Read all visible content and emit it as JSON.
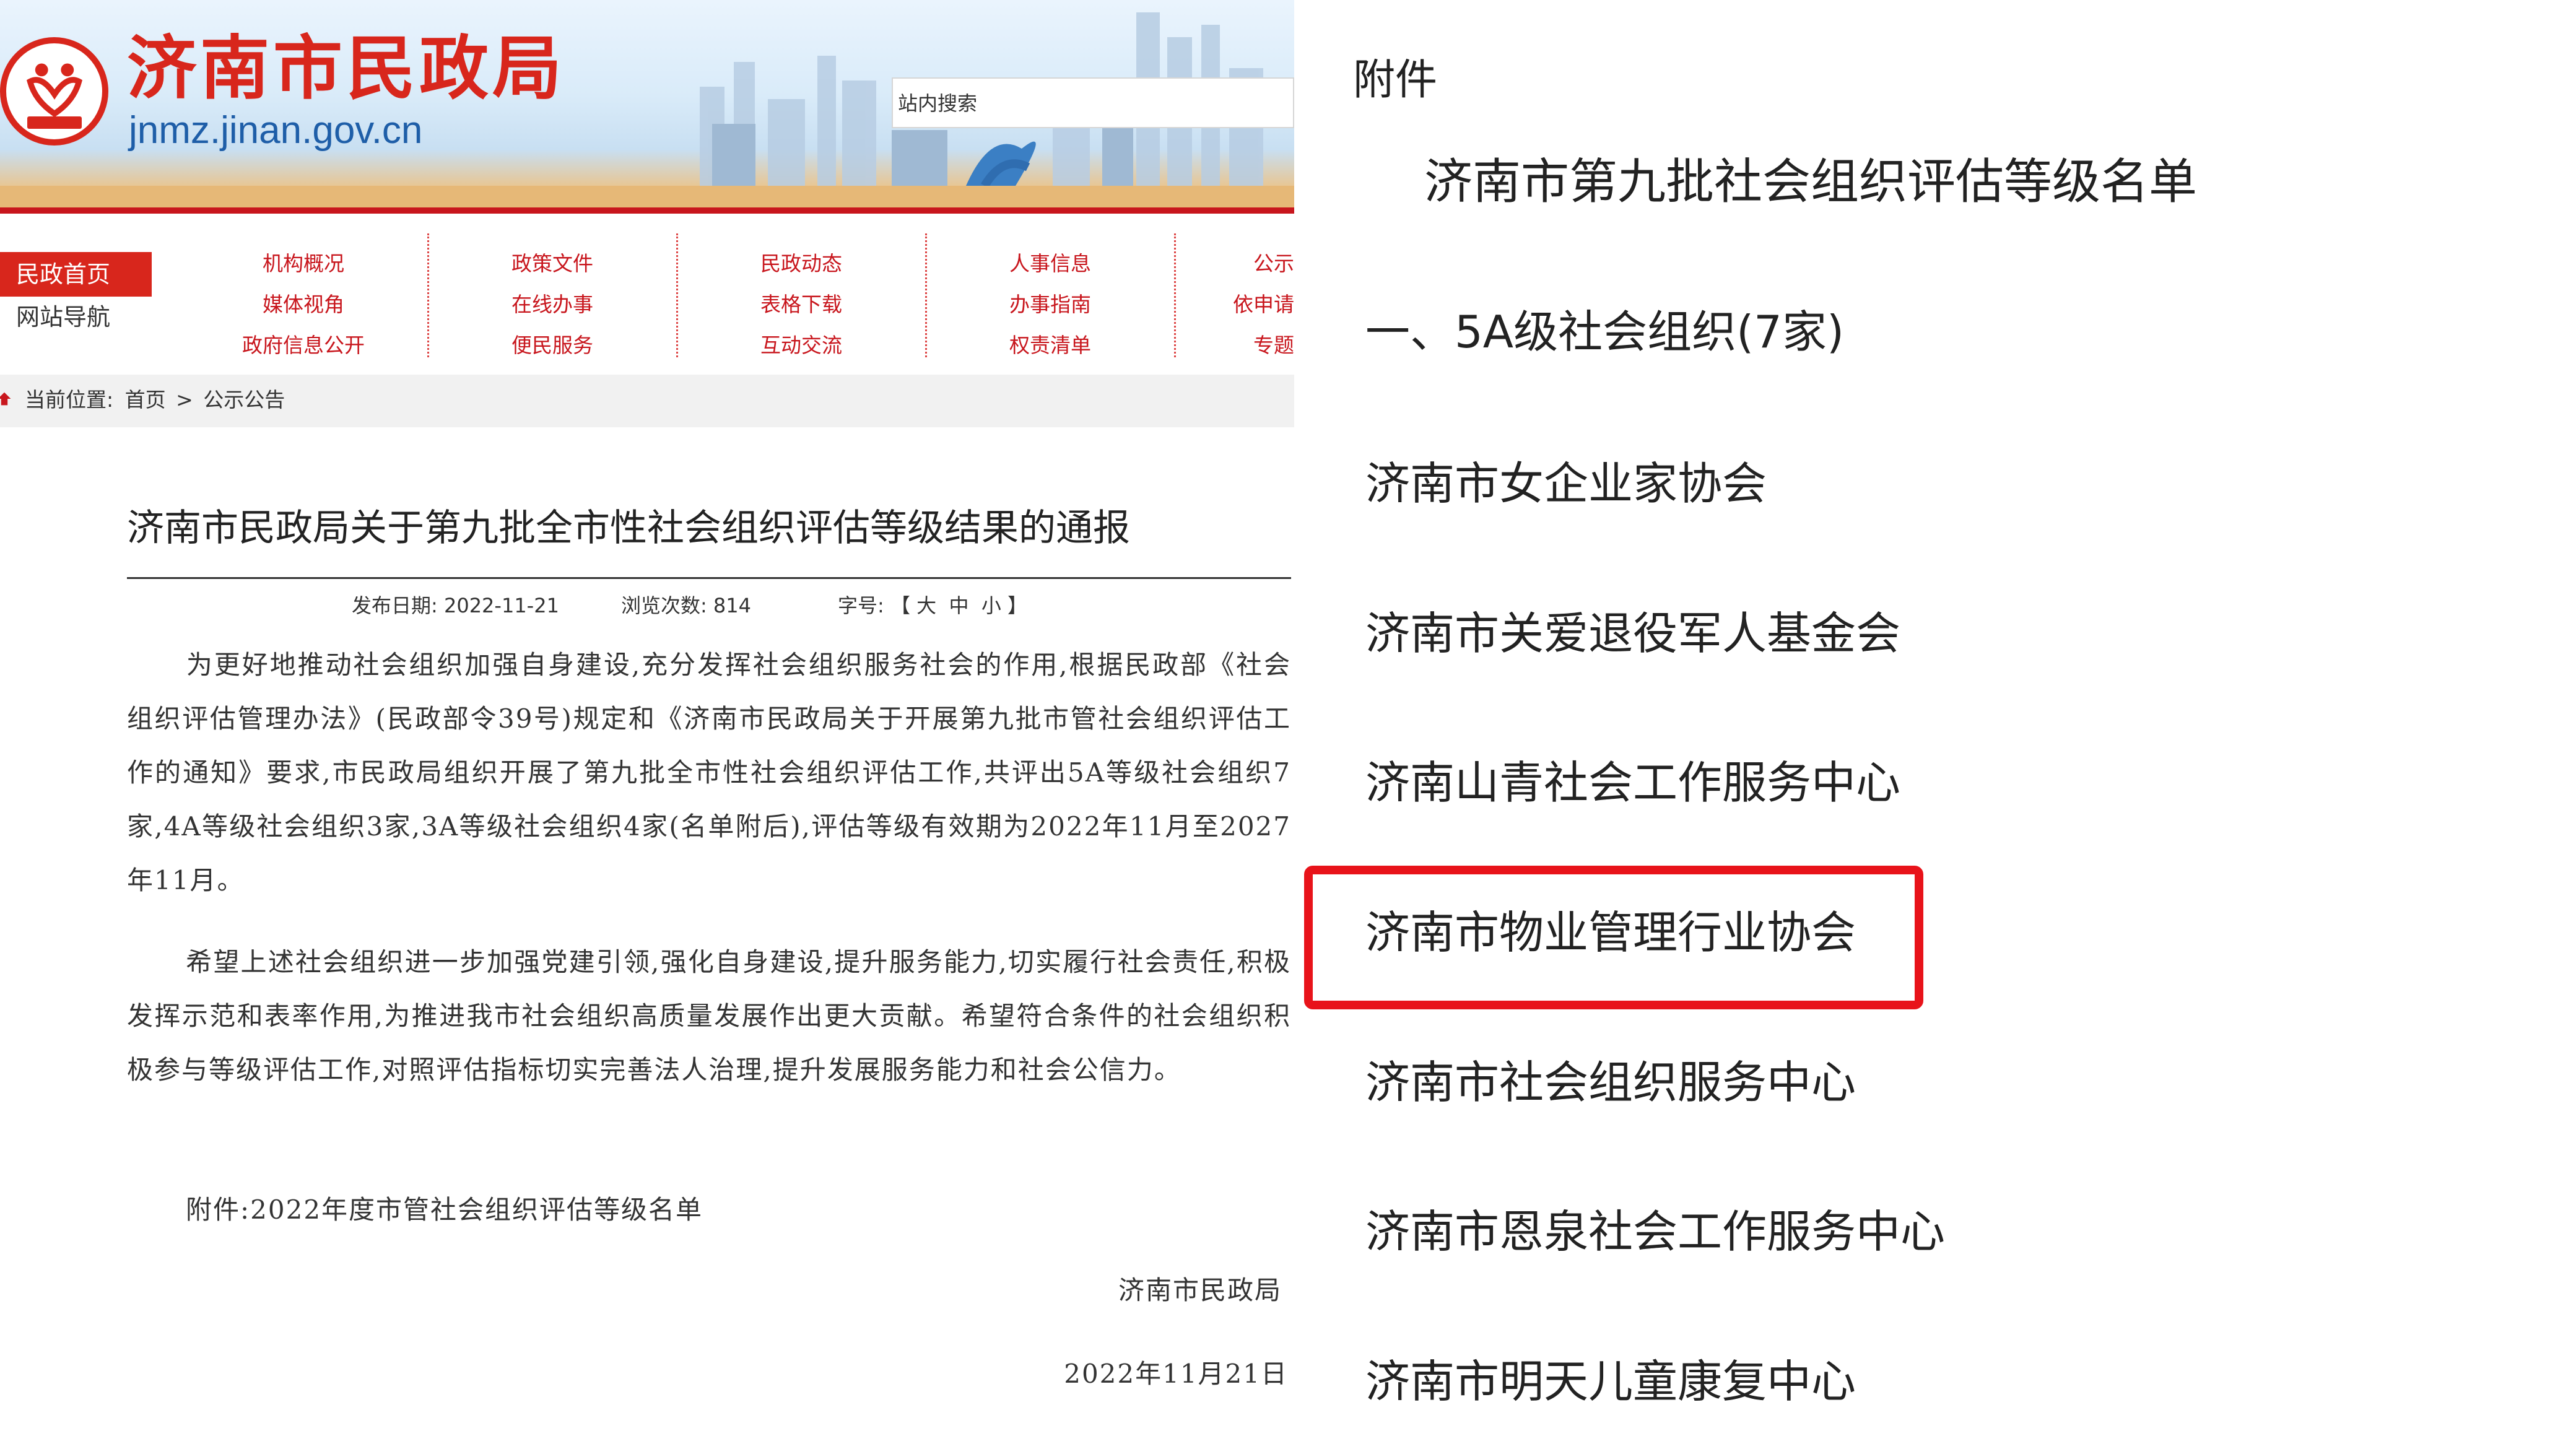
{
  "site": {
    "title": "济南市民政局",
    "domain": "jnmz.jinan.gov.cn",
    "search_placeholder": "站内搜索"
  },
  "nav": {
    "home": "民政首页",
    "site_nav": "网站导航",
    "columns": [
      [
        "机构概况",
        "媒体视角",
        "政府信息公开"
      ],
      [
        "政策文件",
        "在线办事",
        "便民服务"
      ],
      [
        "民政动态",
        "表格下载",
        "互动交流"
      ],
      [
        "人事信息",
        "办事指南",
        "权责清单"
      ],
      [
        "公示",
        "依申请",
        "专题"
      ]
    ]
  },
  "breadcrumb": {
    "label": "当前位置:",
    "home": "首页",
    "separator": ">",
    "current": "公示公告"
  },
  "article": {
    "title": "济南市民政局关于第九批全市性社会组织评估等级结果的通报",
    "date_label": "发布日期:",
    "date": "2022-11-21",
    "views_label": "浏览次数:",
    "views": "814",
    "font_label": "字号:",
    "font_sizes": [
      "【",
      "大",
      "中",
      "小",
      "】"
    ],
    "paragraphs": [
      "为更好地推动社会组织加强自身建设,充分发挥社会组织服务社会的作用,根据民政部《社会组织评估管理办法》(民政部令39号)规定和《济南市民政局关于开展第九批市管社会组织评估工作的通知》要求,市民政局组织开展了第九批全市性社会组织评估工作,共评出5A等级社会组织7家,4A等级社会组织3家,3A等级社会组织4家(名单附后),评估等级有效期为2022年11月至2027年11月。",
      "希望上述社会组织进一步加强党建引领,强化自身建设,提升服务能力,切实履行社会责任,积极发挥示范和表率作用,为推进我市社会组织高质量发展作出更大贡献。希望符合条件的社会组织积极参与等级评估工作,对照评估指标切实完善法人治理,提升发展服务能力和社会公信力。",
      "附件:2022年度市管社会组织评估等级名单"
    ],
    "signature": "济南市民政局",
    "sign_date": "2022年11月21日"
  },
  "attachment": {
    "label": "附件",
    "title": "济南市第九批社会组织评估等级名单",
    "section": "一、5A级社会组织(7家)",
    "orgs": [
      "济南市女企业家协会",
      "济南市关爱退役军人基金会",
      "济南山青社会工作服务中心",
      "济南市物业管理行业协会",
      "济南市社会组织服务中心",
      "济南市恩泉社会工作服务中心",
      "济南市明天儿童康复中心"
    ],
    "highlighted_index": 3
  },
  "colors": {
    "brand_red": "#d8261c",
    "domain_blue": "#1e5ea8",
    "highlight_red": "#e8131a"
  }
}
